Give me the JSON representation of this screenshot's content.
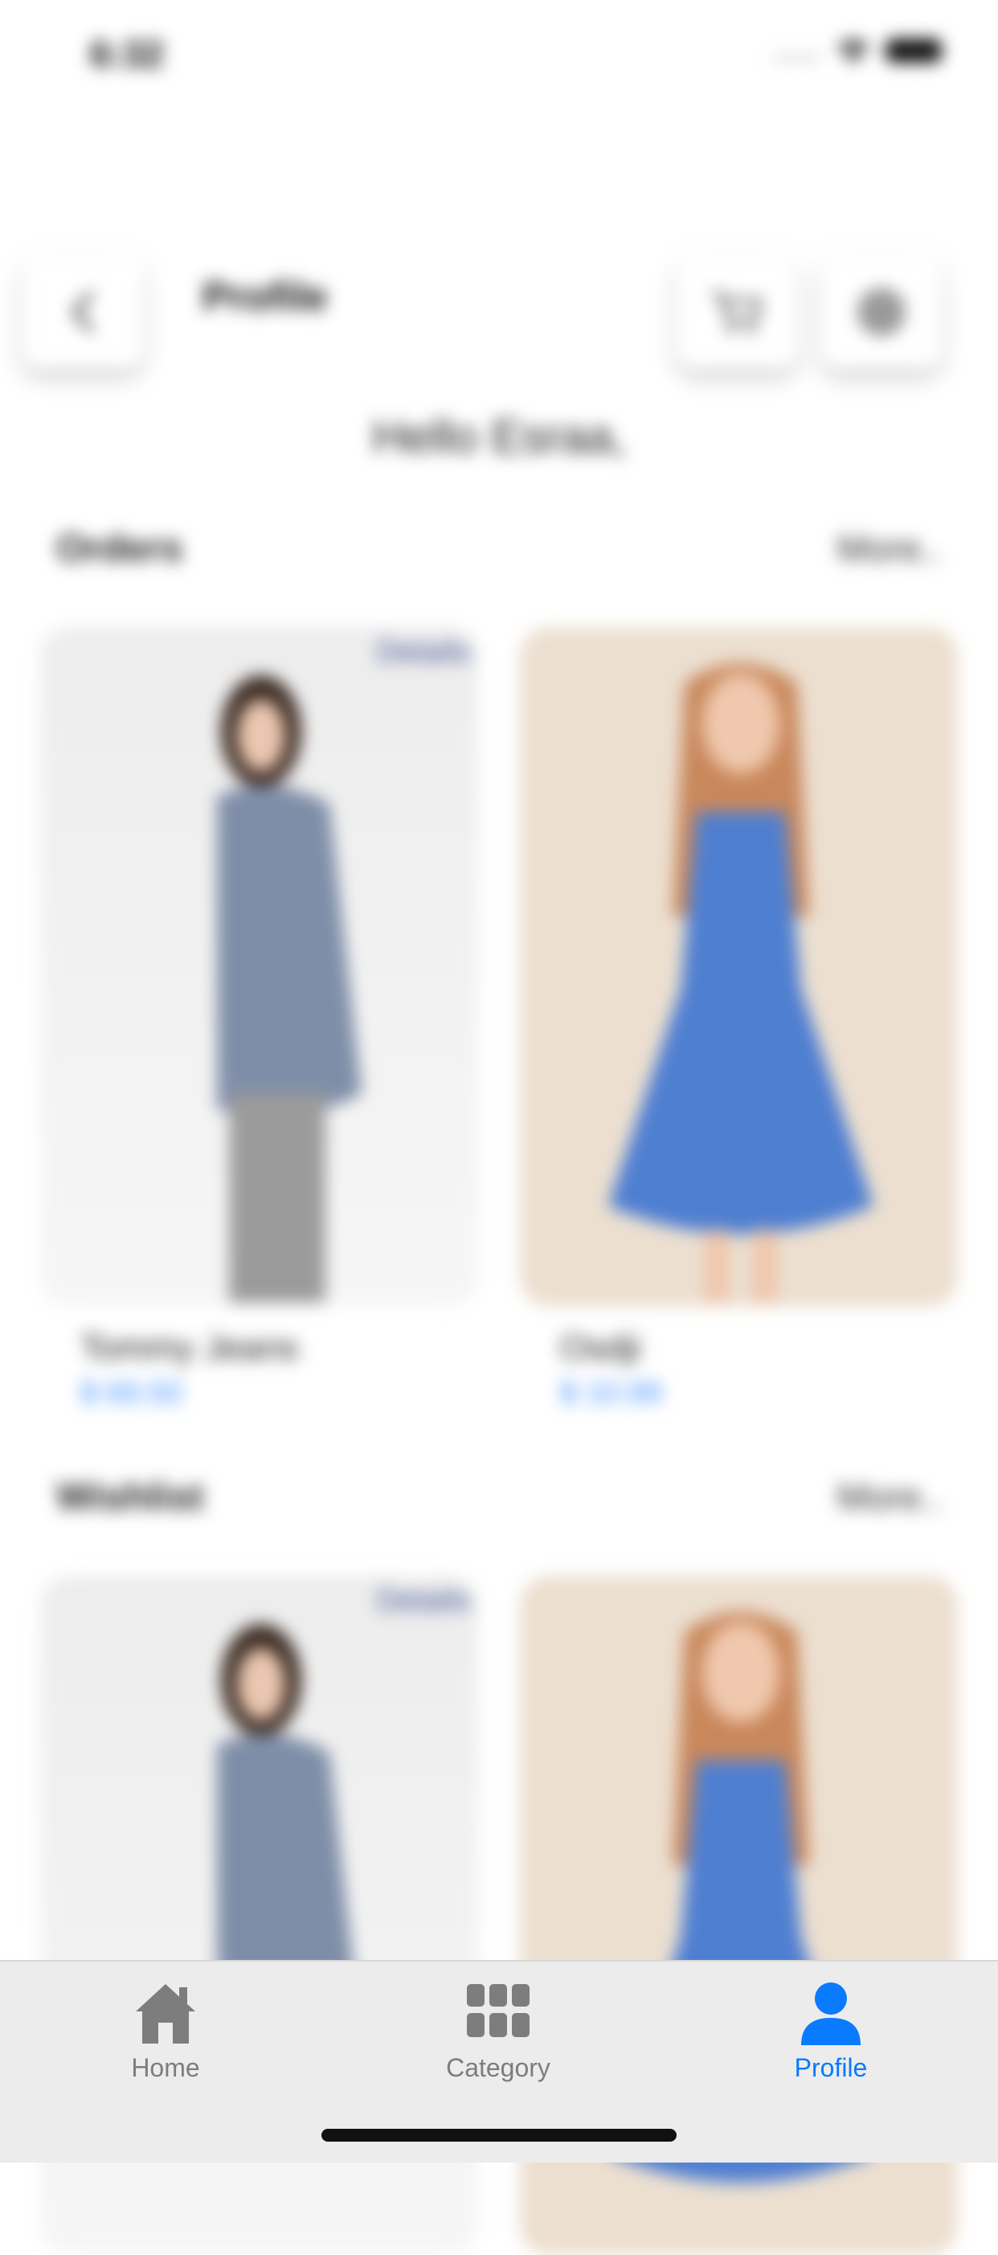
{
  "status_bar": {
    "time": "6:32"
  },
  "header": {
    "title": "Profile"
  },
  "greeting": "Hello Esraa,",
  "orders": {
    "title": "Orders",
    "more_label": "More..",
    "items": [
      {
        "name": "Tommy Jeans",
        "price": "$ 69.50",
        "details_label": "Details"
      },
      {
        "name": "Osdji",
        "price": "$ 10.99"
      }
    ]
  },
  "wishlist": {
    "title": "Wishlist",
    "more_label": "More..",
    "items": [
      {
        "details_label": "Details"
      },
      {}
    ]
  },
  "tabbar": {
    "tabs": [
      {
        "label": "Home",
        "icon": "house-icon"
      },
      {
        "label": "Category",
        "icon": "grid-icon"
      },
      {
        "label": "Profile",
        "icon": "person-icon",
        "active": true
      }
    ]
  },
  "colors": {
    "accent": "#0A7AFF",
    "price": "#3A8CFF",
    "inactive_tab": "#7D7D7D"
  }
}
